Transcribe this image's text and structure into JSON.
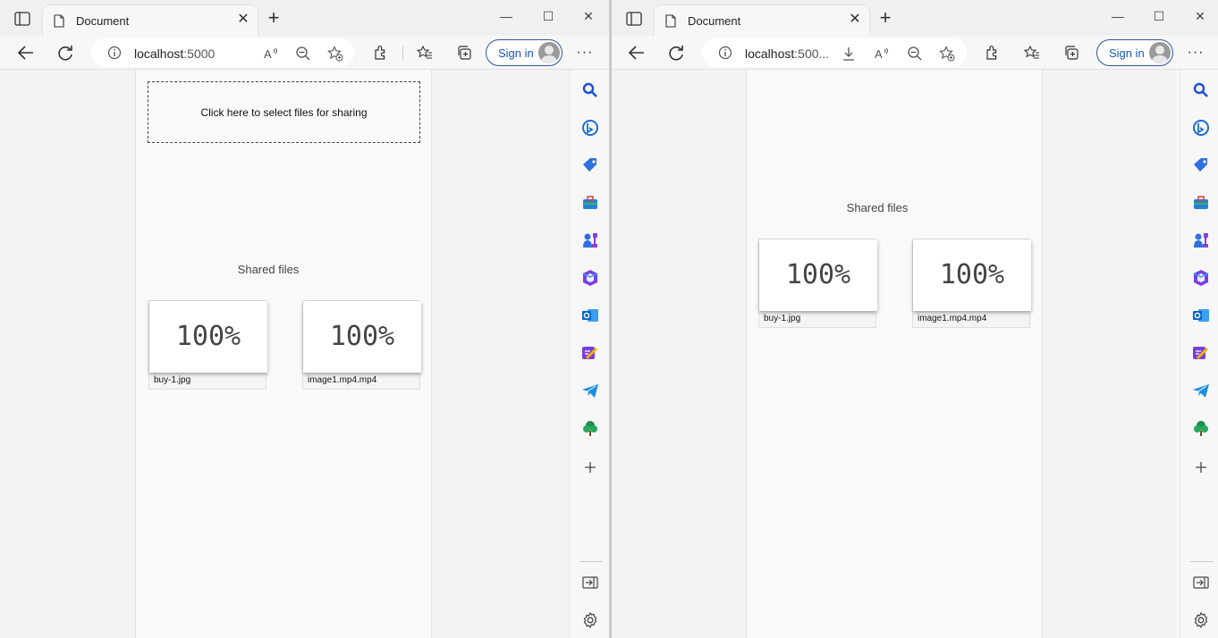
{
  "tab": {
    "title": "Document"
  },
  "windowA": {
    "url_host": "localhost",
    "url_port": ":5000",
    "signin_label": "Sign in",
    "dropzone_text": "Click here to select files for sharing",
    "shared_heading": "Shared files",
    "files": [
      {
        "progress": "100%",
        "name": "buy-1.jpg"
      },
      {
        "progress": "100%",
        "name": "image1.mp4.mp4"
      }
    ]
  },
  "windowB": {
    "url_host": "localhost",
    "url_port": ":500...",
    "signin_label": "Sign in",
    "shared_heading": "Shared files",
    "files": [
      {
        "progress": "100%",
        "name": "buy-1.jpg"
      },
      {
        "progress": "100%",
        "name": "image1.mp4.mp4"
      }
    ]
  },
  "icons": {
    "sidebar": [
      "search-icon",
      "bing-chat-icon",
      "shopping-tag-icon",
      "tools-icon",
      "games-icon",
      "office-icon",
      "outlook-icon",
      "designer-icon",
      "telegram-icon",
      "tree-icon",
      "add-icon",
      "collapse-sidebar-icon",
      "settings-icon"
    ],
    "toolbar": [
      "back-icon",
      "refresh-icon",
      "read-aloud-icon",
      "zoom-out-icon",
      "add-favorite-icon",
      "extensions-icon",
      "favorites-icon",
      "collections-icon",
      "more-icon"
    ]
  },
  "colors": {
    "accent": "#1a56b4",
    "page_bg": "#f9f9f9",
    "chrome_bg": "#f7f7f7"
  }
}
